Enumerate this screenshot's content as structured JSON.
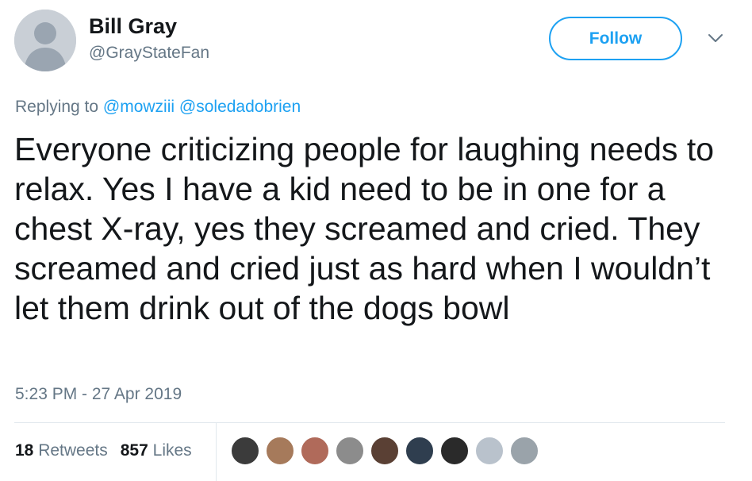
{
  "user": {
    "display_name": "Bill Gray",
    "handle": "@GrayStateFan"
  },
  "actions": {
    "follow_label": "Follow",
    "more_icon": "chevron-down-icon"
  },
  "reply": {
    "prefix": "Replying to",
    "mentions": [
      "@mowziii",
      "@soledadobrien"
    ]
  },
  "tweet": {
    "text": "Everyone criticizing people for laughing needs to relax. Yes I have a kid need to be in one for a chest X-ray, yes they screamed and cried. They screamed and cried just as hard when I wouldn’t let them drink out of the dogs bowl",
    "timestamp": "5:23 PM - 27 Apr 2019"
  },
  "stats": {
    "retweets_count": "18",
    "retweets_label": "Retweets",
    "likes_count": "857",
    "likes_label": "Likes"
  },
  "likers": [
    {
      "color": "#3b3b3b"
    },
    {
      "color": "#a67a5b"
    },
    {
      "color": "#b06a5a"
    },
    {
      "color": "#8c8c8c"
    },
    {
      "color": "#5a4034"
    },
    {
      "color": "#2f3e4f"
    },
    {
      "color": "#2a2a2a"
    },
    {
      "color": "#b9c2cc"
    },
    {
      "color": "#9aa3aa"
    }
  ],
  "colors": {
    "accent": "#1da1f2",
    "secondary_text": "#657786",
    "primary_text": "#14171a",
    "divider": "#e1e8ed"
  }
}
